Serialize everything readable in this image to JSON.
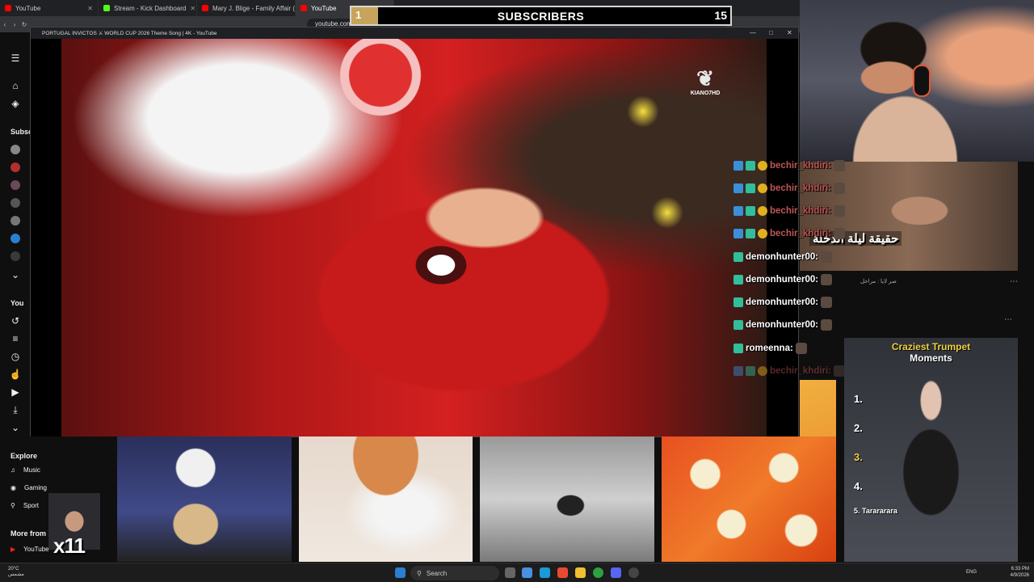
{
  "browser": {
    "tabs": [
      {
        "label": "YouTube",
        "fav_color": "#ff0000",
        "active": false
      },
      {
        "label": "Stream - Kick Dashboard",
        "fav_color": "#53fc18",
        "active": false
      },
      {
        "label": "Mary J. Blige - Family Affair (Offi",
        "fav_color": "#ff0000",
        "active": false
      },
      {
        "label": "YouTube",
        "fav_color": "#ff0000",
        "active": true
      }
    ],
    "url": "youtube.com"
  },
  "popup": {
    "title": "PORTUGAL INVICTOS ⚔ WORLD CUP 2026 Theme Song | 4K - YouTube",
    "watermark": "KIANO7HD"
  },
  "subscribers": {
    "start": "1",
    "label": "SUBSCRIBERS",
    "goal": "15",
    "progress": 0.07
  },
  "sidebar": {
    "subscriptions_label": "Subsc",
    "you_label": "You",
    "explore_label": "Explore",
    "explore_items": [
      "Music",
      "Gaming",
      "Sport"
    ],
    "more_from_label": "More from Y",
    "youtube_item": "YouTube"
  },
  "chat": {
    "rows": [
      {
        "name": "bechir_khdiri:",
        "faded": true
      },
      {
        "name": "bechir_khdiri:",
        "faded": true
      },
      {
        "name": "bechir_khdiri:",
        "faded": true
      },
      {
        "name": "bechir_khdiri:",
        "faded": true
      },
      {
        "name": "demonhunter00:",
        "faded": false
      },
      {
        "name": "demonhunter00:",
        "faded": false
      },
      {
        "name": "demonhunter00:",
        "faded": false
      },
      {
        "name": "demonhunter00:",
        "faded": false
      },
      {
        "name": "romeenna:",
        "faded": false
      },
      {
        "name": "bechir_khdiri:",
        "faded": true
      }
    ]
  },
  "short": {
    "caption": "حقيقة ليلة الدخلة",
    "meta": "صر لايا : مراحل"
  },
  "trumpet": {
    "title_yellow": "Craziest Trumpet",
    "title_white": "Moments",
    "ranks": [
      "1.",
      "2.",
      "3.",
      "4."
    ],
    "rank5": "5. Tarararara"
  },
  "overlay": {
    "multiplier": "x11"
  },
  "taskbar": {
    "weather_temp": "20°C",
    "weather_desc": "مشمس",
    "search_label": "Search",
    "lang": "ENG",
    "time": "6:33 PM",
    "date": "4/9/2026"
  }
}
